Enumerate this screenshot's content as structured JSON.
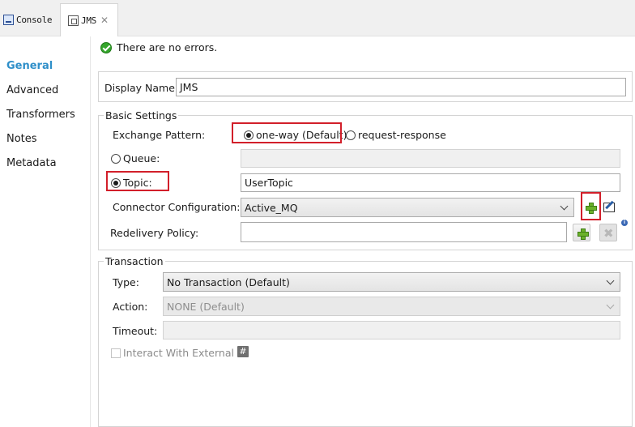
{
  "tabs": {
    "console": "Console",
    "jms": "JMS"
  },
  "nav": [
    "General",
    "Advanced",
    "Transformers",
    "Notes",
    "Metadata"
  ],
  "status": "There are no errors.",
  "display_name": {
    "label": "Display Name:",
    "value": "JMS"
  },
  "basic_settings": {
    "title": "Basic Settings",
    "exchange_pattern_label": "Exchange Pattern:",
    "one_way": "one-way (Default)",
    "request_response": "request-response",
    "queue_label": "Queue:",
    "queue_value": "",
    "topic_label": "Topic:",
    "topic_value": "UserTopic",
    "connector_label": "Connector Configuration:",
    "connector_value": "Active_MQ",
    "redelivery_label": "Redelivery Policy:",
    "redelivery_value": ""
  },
  "transaction": {
    "title": "Transaction",
    "type_label": "Type:",
    "type_value": "No Transaction (Default)",
    "action_label": "Action:",
    "action_value": "NONE (Default)",
    "timeout_label": "Timeout:",
    "timeout_value": "",
    "interact_label": "Interact With External"
  },
  "colors": {
    "nav_active": "#2f8fc9",
    "highlight": "#d21f2a",
    "ok": "#34a52b"
  }
}
